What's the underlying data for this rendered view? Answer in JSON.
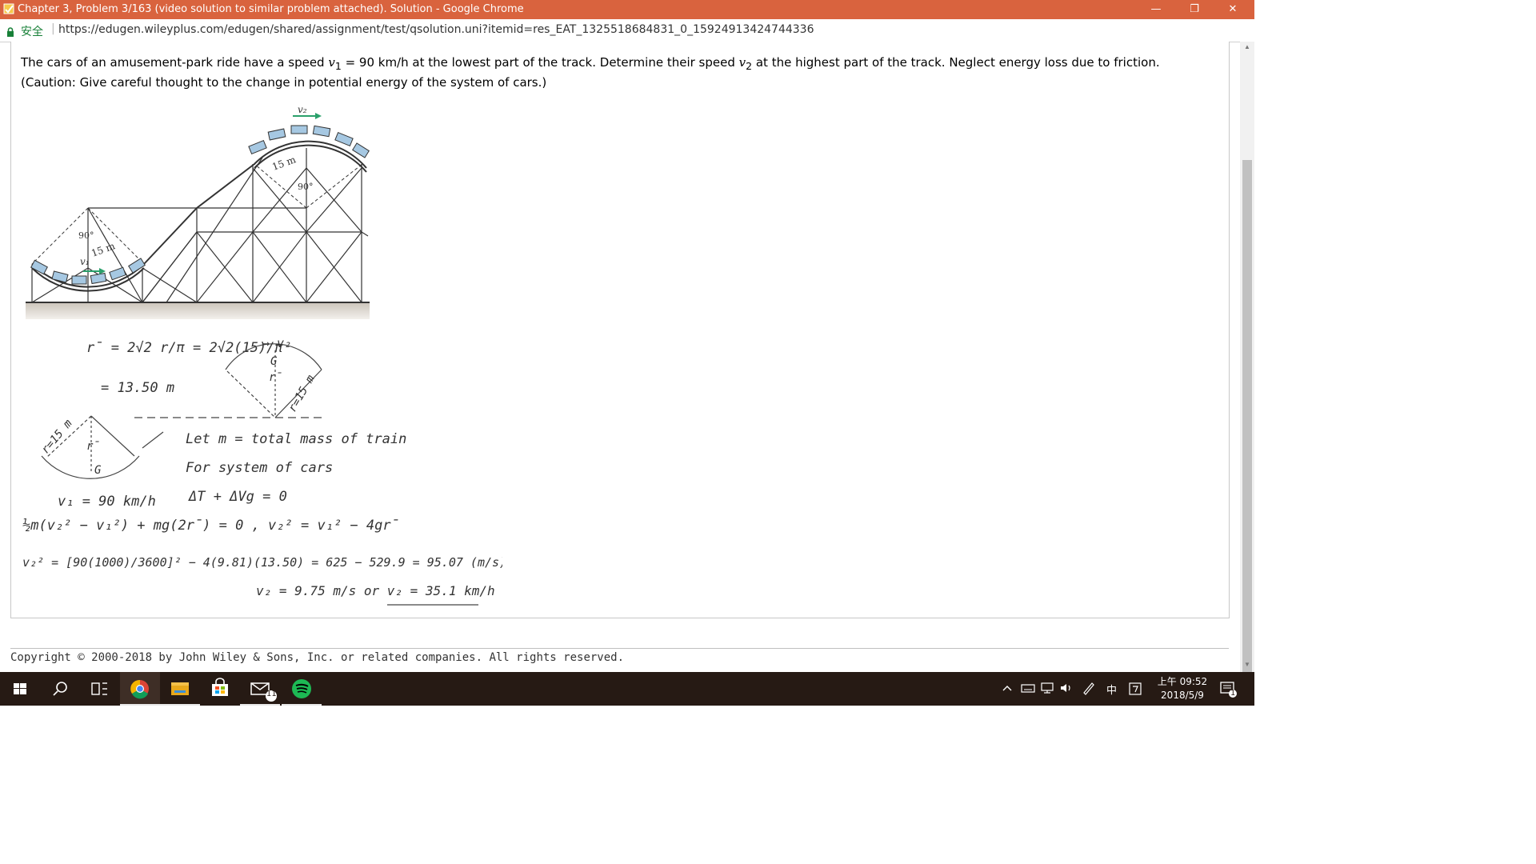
{
  "window": {
    "title": "Chapter 3, Problem 3/163 (video solution to similar problem attached). Solution - Google Chrome",
    "buttons": {
      "minimize": "—",
      "restore": "❐",
      "close": "✕"
    }
  },
  "address_bar": {
    "secure_label": "安全",
    "url": "https://edugen.wileyplus.com/edugen/shared/assignment/test/qsolution.uni?itemid=res_EAT_1325518684831_0_15924913424744336"
  },
  "problem": {
    "p1": "The cars of an amusement-park ride have a speed ",
    "v1": "v",
    "v1_sub": "1",
    "p2": " = 90 km/h at the lowest part of the track. Determine their speed ",
    "v2": "v",
    "v2_sub": "2",
    "p3": " at the highest part of the track. Neglect energy loss due to friction.",
    "line2": "(Caution: Give careful thought to the change in potential energy of the system of cars.)"
  },
  "figure": {
    "v2_label": "v₂",
    "radius_top": "15 m",
    "angle_top": "90°",
    "angle_bottom": "90°",
    "radius_bottom": "15 m",
    "v1_label": "v₁"
  },
  "solution": {
    "rbar_eq": "r̄ = 2√2 r/π = 2√2(15)/π",
    "rbar_val": "= 13.50 m",
    "v2_arrow": "→ v₂",
    "g_top": "G",
    "rbar_top": "r̄",
    "r_top": "r=15 m",
    "r_bottom": "r=15 m",
    "rbar_bottom": "r̄",
    "g_bottom": "G",
    "v1_val": "v₁ = 90 km/h",
    "let_m": "Let m = total mass of train",
    "system": "For system of cars",
    "energy": "ΔT + ΔVg = 0",
    "eq1": "½m(v₂² − v₁²) + mg(2r̄) = 0 ,  v₂² = v₁² − 4gr̄",
    "eq2": "v₂² = [90(1000)/3600]² − 4(9.81)(13.50) = 625 − 529.9 = 95.07 (m/s)²",
    "result": "v₂ = 9.75 m/s  or  v₂ = 35.1 km/h"
  },
  "footer": {
    "copyright": "Copyright © 2000-2018 by John Wiley & Sons, Inc. or related companies. All rights reserved."
  },
  "taskbar": {
    "mail_badge": "11",
    "tray_ime": "中",
    "clock_time": "上午 09:52",
    "clock_date": "2018/5/9",
    "notification_badge": "1"
  }
}
